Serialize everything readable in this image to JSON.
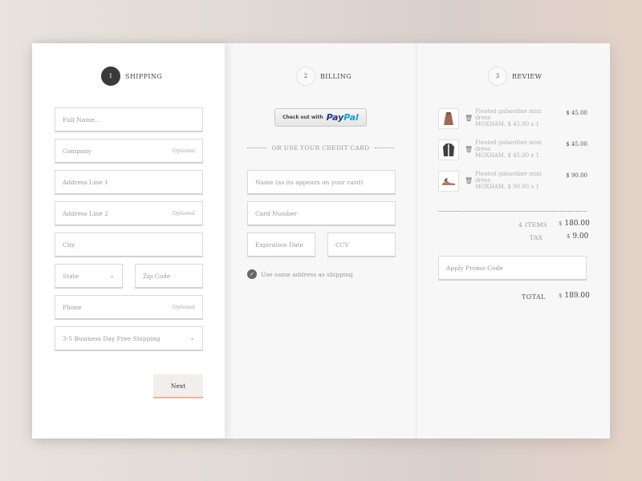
{
  "steps": [
    {
      "num": "1",
      "label": "SHIPPING"
    },
    {
      "num": "2",
      "label": "BILLING"
    },
    {
      "num": "3",
      "label": "REVIEW"
    }
  ],
  "shipping": {
    "full_name": {
      "placeholder": "Full Name..."
    },
    "company": {
      "placeholder": "Company",
      "optional": "Optional"
    },
    "address1": {
      "placeholder": "Address Line 1"
    },
    "address2": {
      "placeholder": "Address Line 2",
      "optional": "Optional"
    },
    "city": {
      "placeholder": "City"
    },
    "state": {
      "placeholder": "State"
    },
    "zip": {
      "placeholder": "Zip Code"
    },
    "phone": {
      "placeholder": "Phone",
      "optional": "Optional"
    },
    "shipping_method": {
      "value": "3-5 Business Day Free Shipping"
    },
    "next_label": "Next"
  },
  "billing": {
    "paypal_prefix": "Check out with",
    "paypal_logo_a": "Pay",
    "paypal_logo_b": "Pal",
    "divider_text": "OR USE YOUR CREDIT CARD",
    "card_name": {
      "placeholder": "Name (as its appears on your card)"
    },
    "card_number": {
      "placeholder": "Card Number"
    },
    "expiration": {
      "placeholder": "Expiration Date"
    },
    "ccv": {
      "placeholder": "CCV"
    },
    "same_address": "Use same address as shipping"
  },
  "review": {
    "items": [
      {
        "name": "Pleated gabardine mini dress",
        "meta": "MOXHAM, $ 45.00 x 1",
        "price": "$ 45.00",
        "icon": "dress-icon"
      },
      {
        "name": "Pleated gabardine mini dress",
        "meta": "MOXHAM, $ 45.00 x 1",
        "price": "$ 45.00",
        "icon": "jacket-icon"
      },
      {
        "name": "Pleated gabardine mini dress",
        "meta": "MOXHAM, $ 90.00 x 1",
        "price": "$ 90.00",
        "icon": "shoes-icon"
      }
    ],
    "items_label": "4 ITEMS",
    "items_currency": "$",
    "items_value": "180.00",
    "tax_label": "TAX",
    "tax_currency": "$",
    "tax_value": "9.00",
    "promo": {
      "placeholder": "Apply Promo Code"
    },
    "total_label": "TOTAL",
    "total_currency": "$",
    "total_value": "189.00"
  }
}
